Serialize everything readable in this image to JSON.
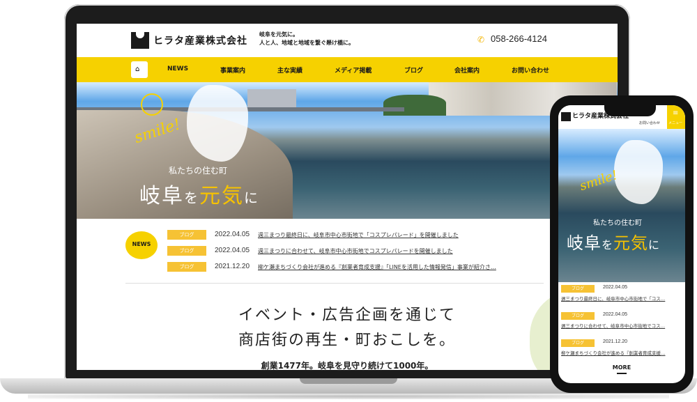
{
  "site": {
    "company": "ヒラタ産業株式会社",
    "tagline_1": "岐阜を元気に。",
    "tagline_2": "人と人、地域と地域を繋ぐ懸け橋に。",
    "phone": "058-266-4124"
  },
  "nav": {
    "home_icon": "home-icon",
    "items": [
      "NEWS",
      "事業案内",
      "主な実績",
      "メディア掲載",
      "ブログ",
      "会社案内",
      "お問い合わせ"
    ]
  },
  "hero": {
    "smile": "smile!",
    "subtitle": "私たちの住む町",
    "title_a": "岐阜",
    "title_b": "を",
    "title_c": "元気",
    "title_d": "に"
  },
  "news": {
    "badge": "NEWS",
    "items": [
      {
        "tag": "ブログ",
        "date": "2022.04.05",
        "title": "週三まつり最終日に、岐阜市中心市街地で「コスプレパレード」を開催しました"
      },
      {
        "tag": "ブログ",
        "date": "2022.04.05",
        "title": "週三まつりに合わせて、岐阜市中心市街地でコスプレパレードを開催しました"
      },
      {
        "tag": "ブログ",
        "date": "2021.12.20",
        "title": "柳ケ瀬まちづくり会社が進める『創業者育成支援』「LINEを活用した情報発信」事業が紹介さ…"
      }
    ]
  },
  "catch": {
    "line1": "イベント・広告企画を通じて",
    "line2": "商店街の再生・町おこしを。",
    "line3": "創業1477年。岐阜を見守り続けて1000年。"
  },
  "mobile": {
    "company": "ヒラタ産業株式会社",
    "contact": "お問い合わせ",
    "menu": "メニュー",
    "menu_icon": "≡",
    "smile": "smile!",
    "subtitle": "私たちの住む町",
    "title_a": "岐阜",
    "title_b": "を",
    "title_c": "元気",
    "title_d": "に",
    "news": [
      {
        "tag": "ブログ",
        "date": "2022.04.05",
        "title": "週三まつり最終日に、岐阜市中心市街地で「コス…"
      },
      {
        "tag": "ブログ",
        "date": "2022.04.05",
        "title": "週三まつりに合わせて、岐阜市中心市街地でコス…"
      },
      {
        "tag": "ブログ",
        "date": "2021.12.20",
        "title": "柳ケ瀬まちづくり会社が進める『創業者育成支援…"
      }
    ],
    "more": "MORE"
  }
}
